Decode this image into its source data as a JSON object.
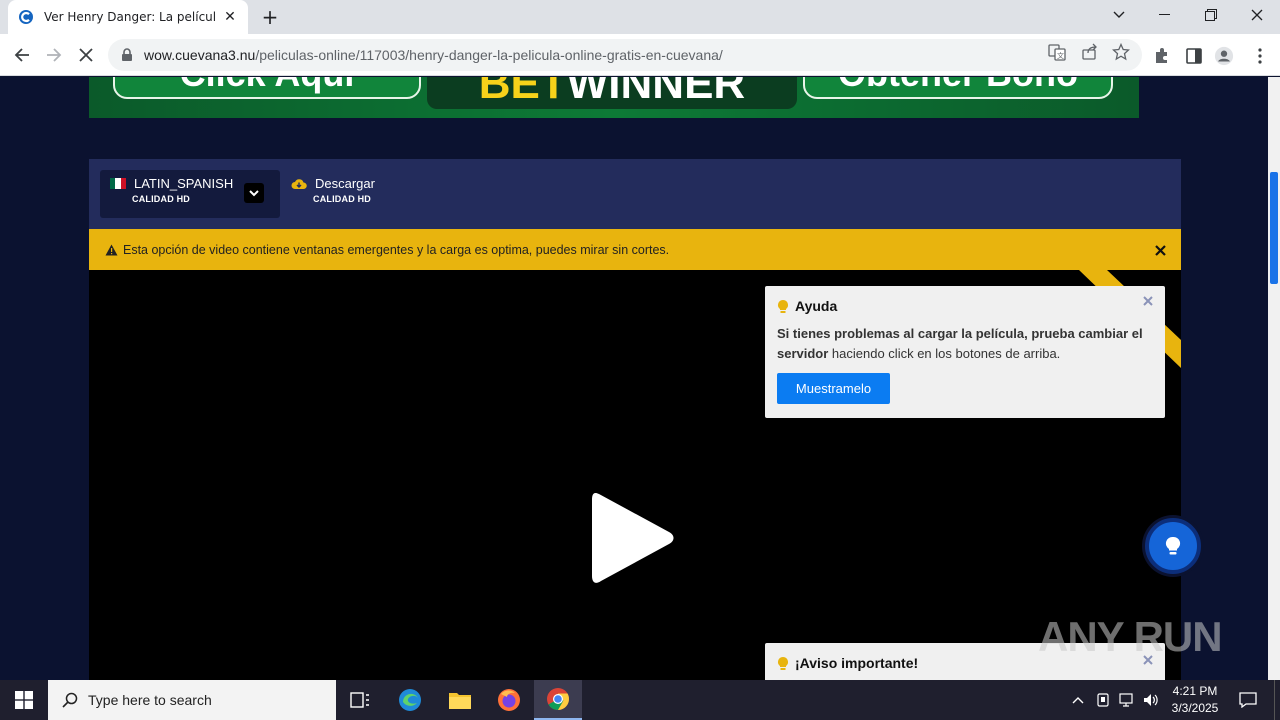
{
  "browser": {
    "tab_title": "Ver Henry Danger: La película Online",
    "url_host": "wow.cuevana3.nu",
    "url_path": "/peliculas-online/117003/henry-danger-la-pelicula-online-gratis-en-cuevana/"
  },
  "ad": {
    "left_text": "Click Aqui",
    "brand_a": "BET",
    "brand_b": "WINNER",
    "right_text": "Obtener Bono"
  },
  "servers": {
    "active_label": "LATIN_SPANISH",
    "active_quality": "CALIDAD HD",
    "download_label": "Descargar",
    "download_quality": "CALIDAD HD"
  },
  "warning": {
    "text": "Esta opción de video contiene ventanas emergentes y la carga es optima, puedes mirar sin cortes."
  },
  "help": {
    "title": "Ayuda",
    "body_bold": "Si tienes problemas al cargar la película, prueba cambiar el servidor",
    "body_rest": " haciendo click en los botones de arriba.",
    "button": "Muestramelo"
  },
  "notice": {
    "title": "¡Aviso importante!"
  },
  "watermark": "ANY RUN",
  "taskbar": {
    "search_placeholder": "Type here to search",
    "time": "4:21 PM",
    "date": "3/3/2025"
  },
  "colors": {
    "warning_bg": "#e8b40e",
    "server_bar": "#232c5c",
    "button_blue": "#0b7cf2",
    "page_bg": "#0b1230"
  }
}
